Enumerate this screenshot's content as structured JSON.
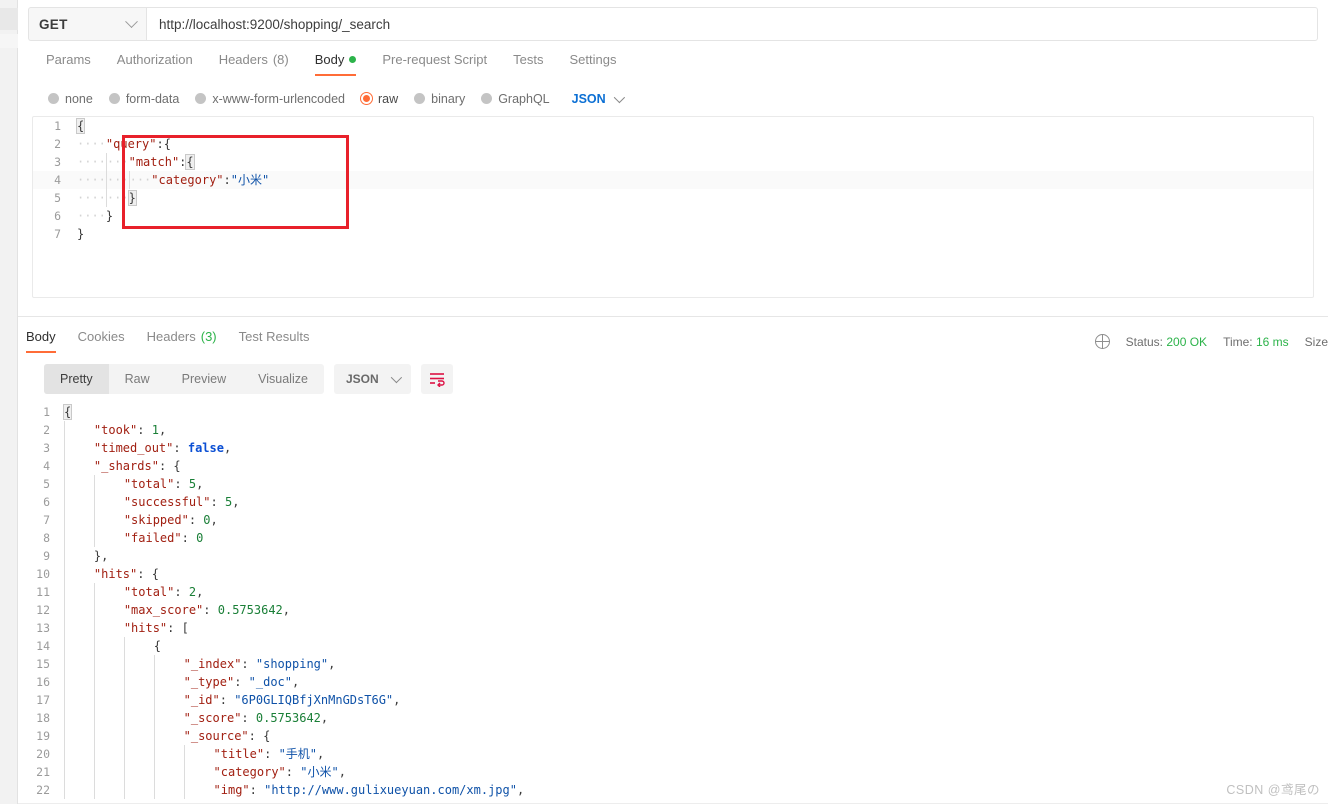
{
  "request": {
    "method": "GET",
    "url": "http://localhost:9200/shopping/_search",
    "tabs": [
      {
        "label": "Params"
      },
      {
        "label": "Authorization"
      },
      {
        "label": "Headers",
        "count": "(8)"
      },
      {
        "label": "Body"
      },
      {
        "label": "Pre-request Script"
      },
      {
        "label": "Tests"
      },
      {
        "label": "Settings"
      }
    ],
    "body_types": [
      {
        "label": "none",
        "selected": false
      },
      {
        "label": "form-data",
        "selected": false
      },
      {
        "label": "x-www-form-urlencoded",
        "selected": false
      },
      {
        "label": "raw",
        "selected": true
      },
      {
        "label": "binary",
        "selected": false
      },
      {
        "label": "GraphQL",
        "selected": false
      }
    ],
    "format": "JSON",
    "editor_lines": [
      {
        "no": "1",
        "content": "{"
      },
      {
        "no": "2",
        "content": "    \"query\":{"
      },
      {
        "no": "3",
        "content": "        \"match\":{"
      },
      {
        "no": "4",
        "content": "            \"category\":\"小米\""
      },
      {
        "no": "5",
        "content": "        }"
      },
      {
        "no": "6",
        "content": "    }"
      },
      {
        "no": "7",
        "content": "}"
      }
    ]
  },
  "response": {
    "tabs": [
      {
        "label": "Body"
      },
      {
        "label": "Cookies"
      },
      {
        "label": "Headers",
        "count": "(3)"
      },
      {
        "label": "Test Results"
      }
    ],
    "status": {
      "status_label": "Status:",
      "status_value": "200 OK",
      "time_label": "Time:",
      "time_value": "16 ms",
      "size_label": "Size"
    },
    "views": [
      {
        "label": "Pretty",
        "active": true
      },
      {
        "label": "Raw",
        "active": false
      },
      {
        "label": "Preview",
        "active": false
      },
      {
        "label": "Visualize",
        "active": false
      }
    ],
    "format": "JSON",
    "body_lines": [
      {
        "no": "1",
        "content": "{"
      },
      {
        "no": "2",
        "content": "    \"took\": 1,"
      },
      {
        "no": "3",
        "content": "    \"timed_out\": false,"
      },
      {
        "no": "4",
        "content": "    \"_shards\": {"
      },
      {
        "no": "5",
        "content": "        \"total\": 5,"
      },
      {
        "no": "6",
        "content": "        \"successful\": 5,"
      },
      {
        "no": "7",
        "content": "        \"skipped\": 0,"
      },
      {
        "no": "8",
        "content": "        \"failed\": 0"
      },
      {
        "no": "9",
        "content": "    },"
      },
      {
        "no": "10",
        "content": "    \"hits\": {"
      },
      {
        "no": "11",
        "content": "        \"total\": 2,"
      },
      {
        "no": "12",
        "content": "        \"max_score\": 0.5753642,"
      },
      {
        "no": "13",
        "content": "        \"hits\": ["
      },
      {
        "no": "14",
        "content": "            {"
      },
      {
        "no": "15",
        "content": "                \"_index\": \"shopping\","
      },
      {
        "no": "16",
        "content": "                \"_type\": \"_doc\","
      },
      {
        "no": "17",
        "content": "                \"_id\": \"6P0GLIQBfjXnMnGDsT6G\","
      },
      {
        "no": "18",
        "content": "                \"_score\": 0.5753642,"
      },
      {
        "no": "19",
        "content": "                \"_source\": {"
      },
      {
        "no": "20",
        "content": "                    \"title\": \"手机\","
      },
      {
        "no": "21",
        "content": "                    \"category\": \"小米\","
      },
      {
        "no": "22",
        "content": "                    \"img\": \"http://www.gulixueyuan.com/xm.jpg\","
      }
    ]
  },
  "watermark": "CSDN @鸢尾の",
  "colors": {
    "accent": "#ff6c37",
    "success": "#2cb34a",
    "link": "#0b6fd4",
    "annotation": "#e8202a"
  }
}
